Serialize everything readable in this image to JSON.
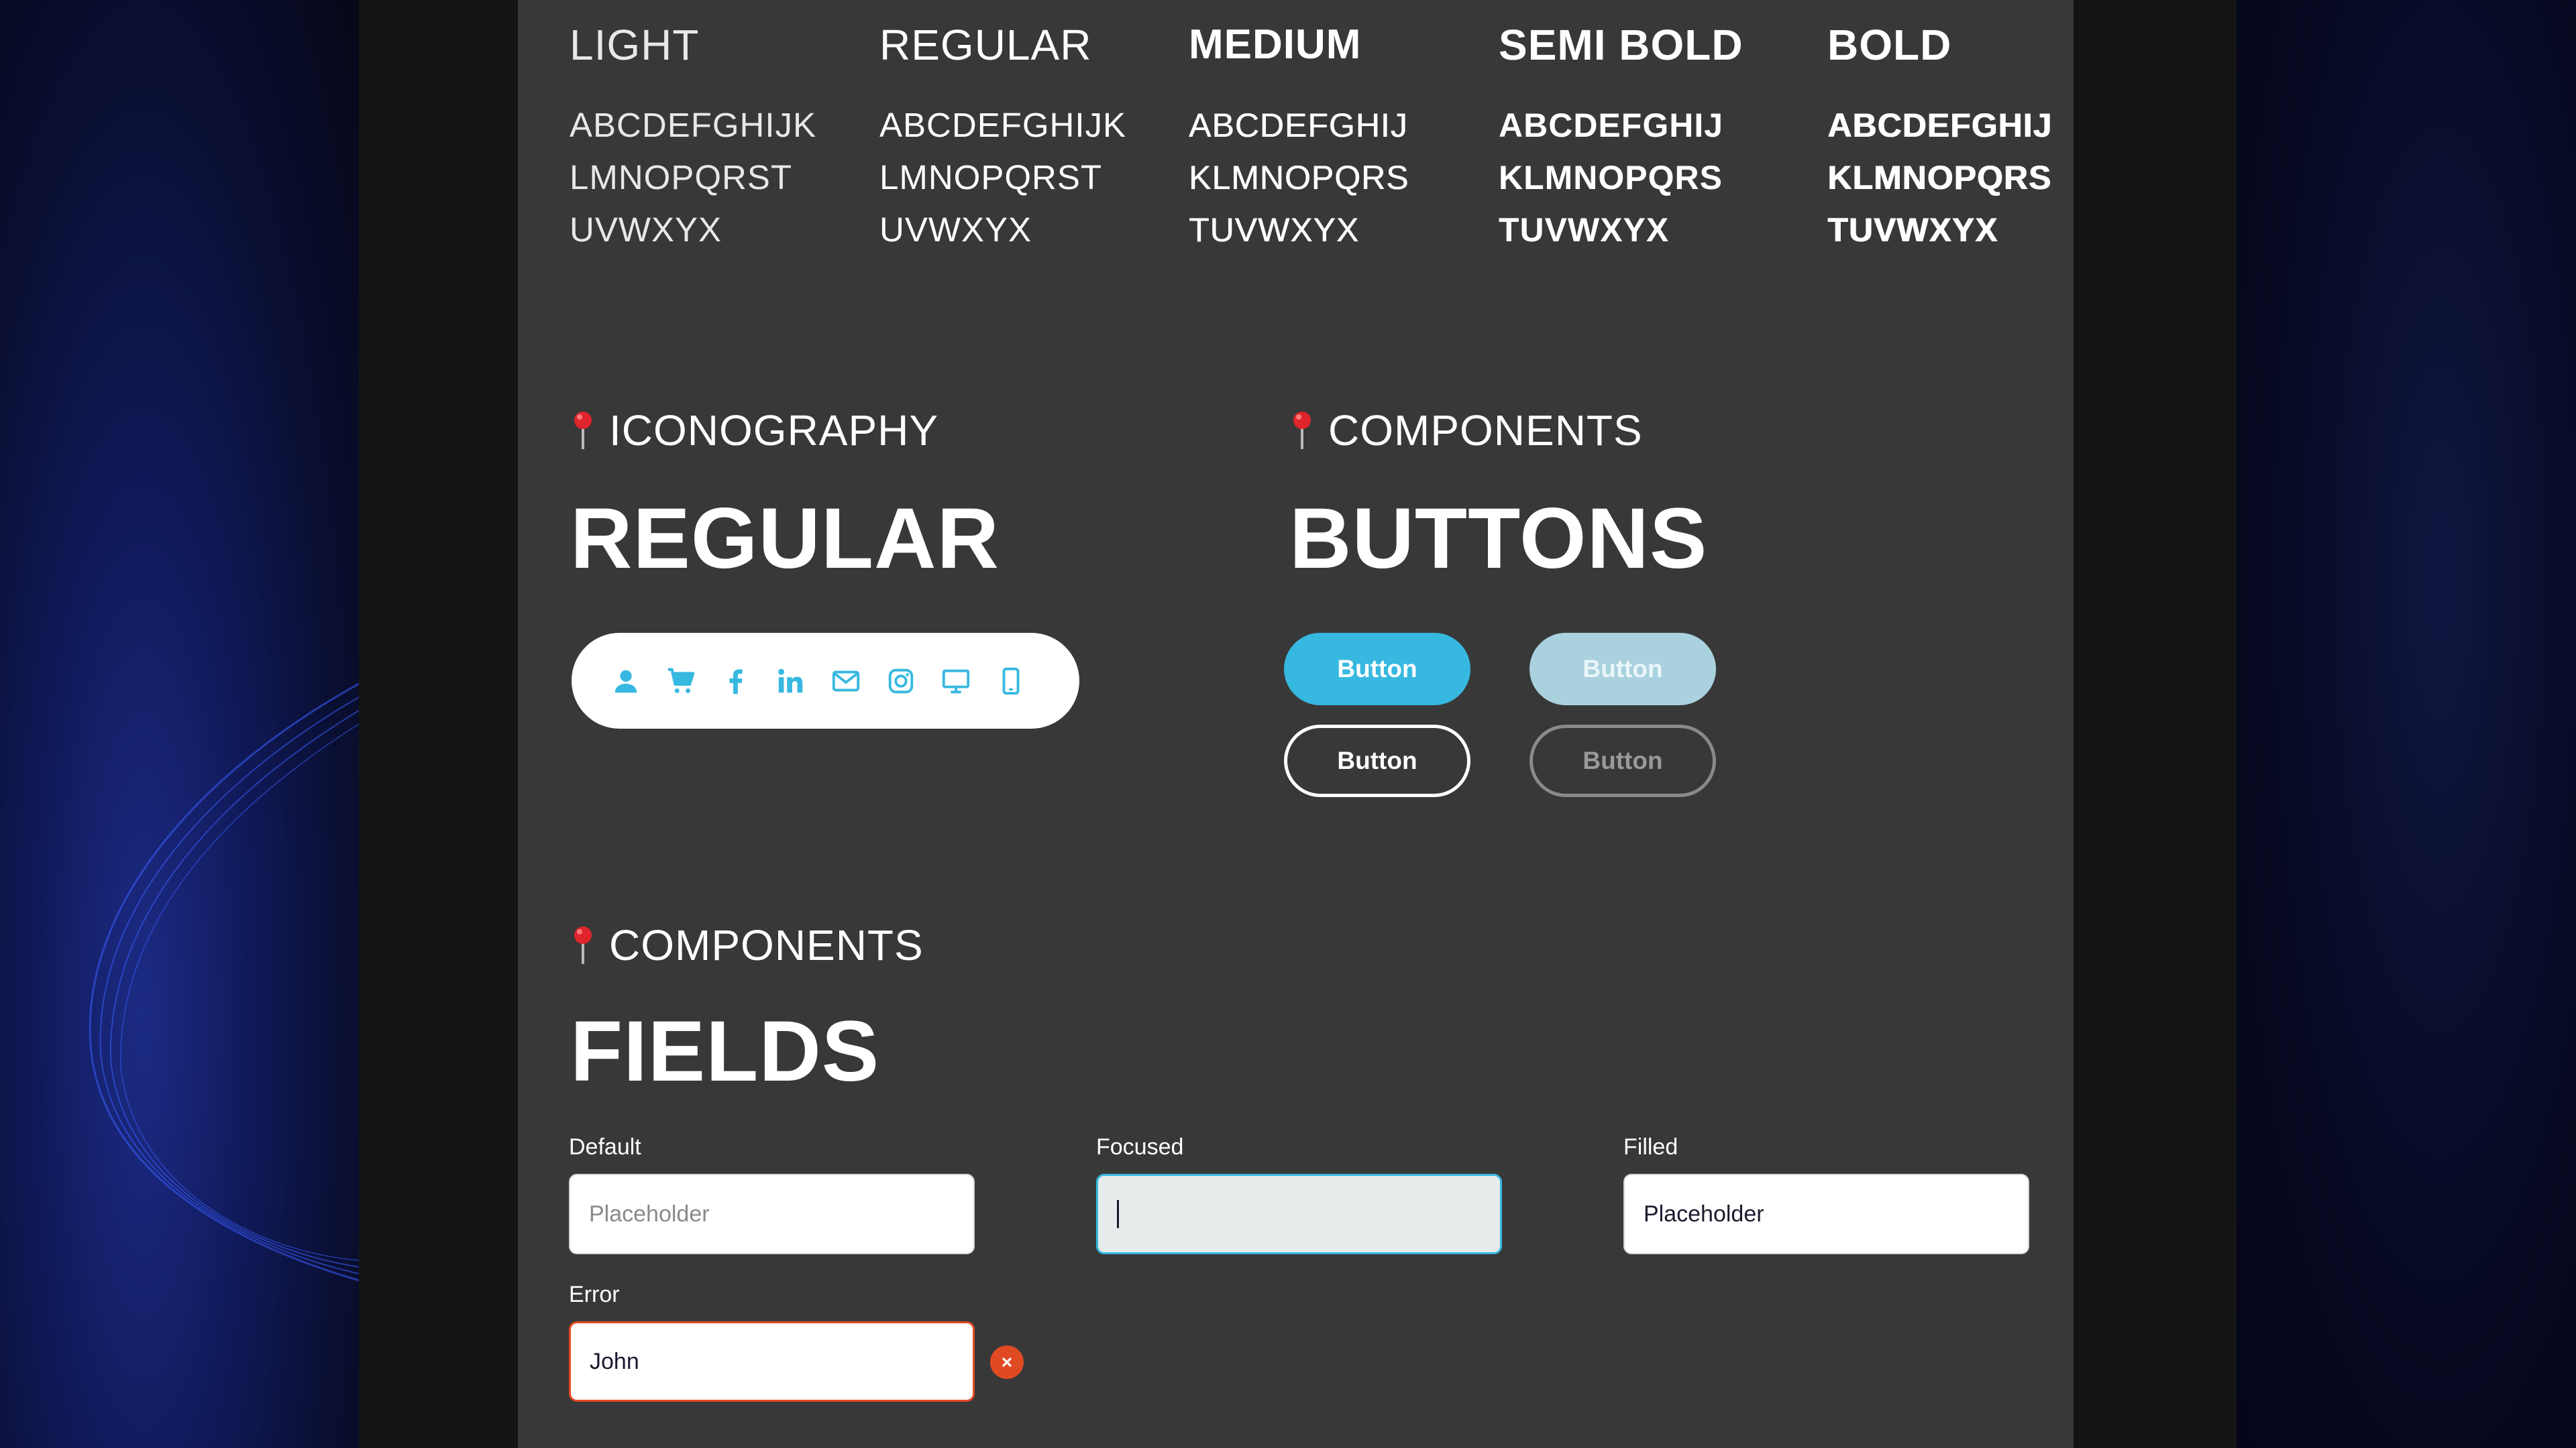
{
  "typography": {
    "weights": [
      {
        "name": "LIGHT",
        "lines": [
          "ABCDEFGHIJK",
          "LMNOPQRST",
          "UVWXYX"
        ]
      },
      {
        "name": "REGULAR",
        "lines": [
          "ABCDEFGHIJK",
          "LMNOPQRST",
          "UVWXYX"
        ]
      },
      {
        "name": "MEDIUM",
        "lines": [
          "ABCDEFGHIJ",
          "KLMNOPQRS",
          "TUVWXYX"
        ]
      },
      {
        "name": "SEMI BOLD",
        "lines": [
          "ABCDEFGHIJ",
          "KLMNOPQRS",
          "TUVWXYX"
        ]
      },
      {
        "name": "BOLD",
        "lines": [
          "ABCDEFGHIJ",
          "KLMNOPQRS",
          "TUVWXYX"
        ]
      }
    ]
  },
  "iconography": {
    "label": "ICONOGRAPHY",
    "heading": "REGULAR",
    "icons": [
      "user-icon",
      "cart-icon",
      "facebook-icon",
      "linkedin-icon",
      "mail-icon",
      "instagram-icon",
      "desktop-icon",
      "mobile-icon"
    ],
    "icon_color": "#36b8e0"
  },
  "buttons_section": {
    "label": "COMPONENTS",
    "heading": "BUTTONS",
    "primary_label": "Button",
    "primary_disabled_label": "Button",
    "outline_label": "Button",
    "outline_disabled_label": "Button",
    "primary_color": "#36b8e0"
  },
  "fields_section": {
    "label": "COMPONENTS",
    "heading": "FIELDS",
    "default": {
      "label": "Default",
      "placeholder": "Placeholder",
      "value": ""
    },
    "focused": {
      "label": "Focused",
      "placeholder": "",
      "value": ""
    },
    "filled": {
      "label": "Filled",
      "value": "Placeholder"
    },
    "error": {
      "label": "Error",
      "value": "John"
    },
    "error_color": "#e04a23"
  },
  "colors": {
    "panel": "#383838",
    "accent": "#36b8e0",
    "pin": "#e0242c"
  }
}
